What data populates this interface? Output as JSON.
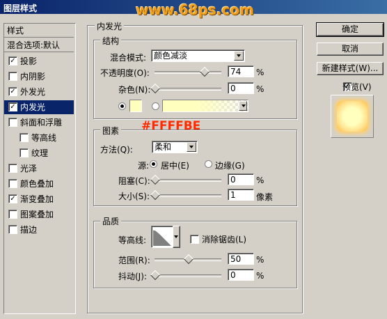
{
  "window": {
    "title": "图层样式",
    "watermark": "www.68ps.com"
  },
  "left_panel": {
    "header": "样式",
    "blend_options": "混合选项:默认",
    "items": [
      {
        "label": "投影",
        "checked": true,
        "indent": false
      },
      {
        "label": "内阴影",
        "checked": false,
        "indent": false
      },
      {
        "label": "外发光",
        "checked": true,
        "indent": false
      },
      {
        "label": "内发光",
        "checked": true,
        "indent": false,
        "selected": true
      },
      {
        "label": "斜面和浮雕",
        "checked": false,
        "indent": false
      },
      {
        "label": "等高线",
        "checked": false,
        "indent": true
      },
      {
        "label": "纹理",
        "checked": false,
        "indent": true
      },
      {
        "label": "光泽",
        "checked": false,
        "indent": false
      },
      {
        "label": "颜色叠加",
        "checked": false,
        "indent": false
      },
      {
        "label": "渐变叠加",
        "checked": true,
        "indent": false
      },
      {
        "label": "图案叠加",
        "checked": false,
        "indent": false
      },
      {
        "label": "描边",
        "checked": false,
        "indent": false
      }
    ]
  },
  "main": {
    "title": "内发光",
    "structure": {
      "legend": "结构",
      "blend_mode_label": "混合模式:",
      "blend_mode_value": "颜色减淡",
      "opacity_label": "不透明度(O):",
      "opacity_value": "74",
      "opacity_unit": "%",
      "noise_label": "杂色(N):",
      "noise_value": "0",
      "noise_unit": "%",
      "color_swatch": "#ffffbe"
    },
    "elements": {
      "legend": "图素",
      "annotation": "#FFFFBE",
      "annotation_color": "#ff2a00",
      "method_label": "方法(Q):",
      "method_value": "柔和",
      "source_label": "源:",
      "source_center": "居中(E)",
      "source_edge": "边缘(G)",
      "choke_label": "阻塞(C):",
      "choke_value": "0",
      "choke_unit": "%",
      "size_label": "大小(S):",
      "size_value": "1",
      "size_unit": "像素"
    },
    "quality": {
      "legend": "品质",
      "contour_label": "等高线:",
      "antialias_label": "消除锯齿(L)",
      "range_label": "范围(R):",
      "range_value": "50",
      "range_unit": "%",
      "jitter_label": "抖动(J):",
      "jitter_value": "0",
      "jitter_unit": "%"
    }
  },
  "right_panel": {
    "ok": "确定",
    "cancel": "取消",
    "new_style": "新建样式(W)...",
    "preview": "预览(V)",
    "preview_checked": true
  }
}
